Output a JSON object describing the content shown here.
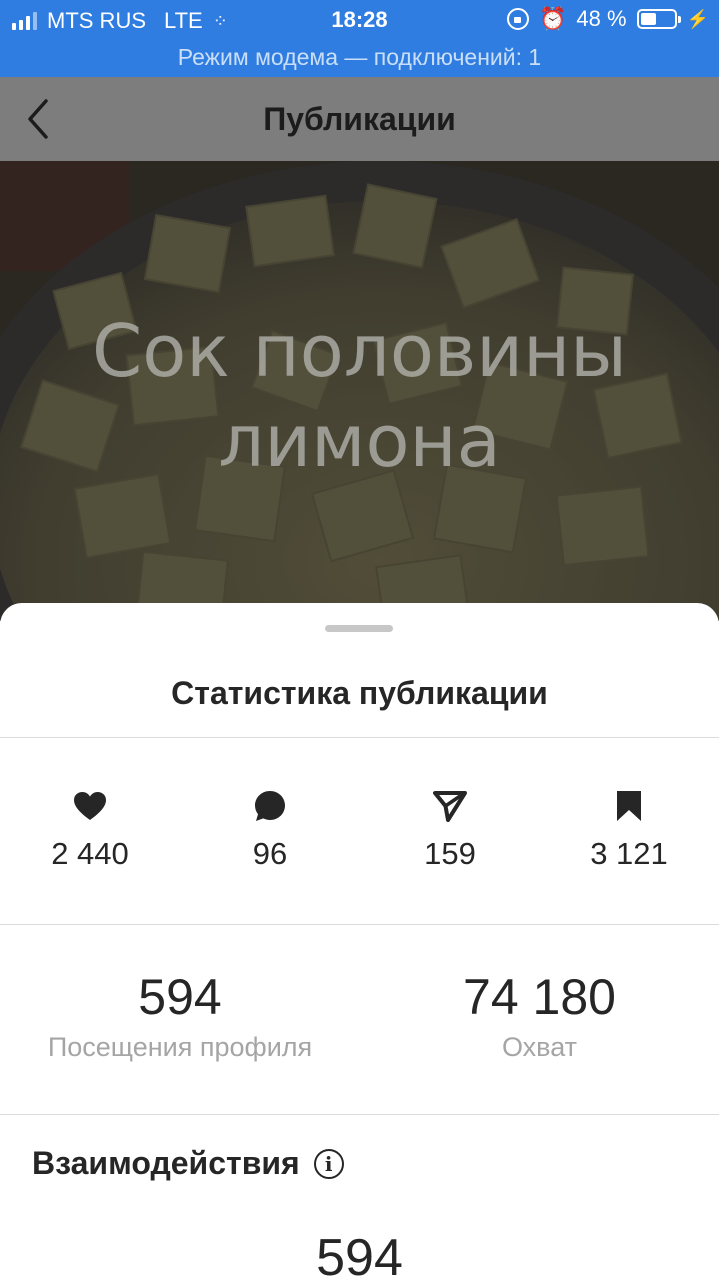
{
  "status_bar": {
    "carrier": "MTS RUS",
    "network": "LTE",
    "time": "18:28",
    "battery_text": "48 %",
    "battery_level": 0.48
  },
  "hotspot_banner": "Режим модема — подключений: 1",
  "header": {
    "title": "Публикации"
  },
  "post": {
    "overlay_text_line1": "Сок половины",
    "overlay_text_line2": "лимона"
  },
  "sheet": {
    "title": "Статистика публикации",
    "metrics": [
      {
        "icon": "heart-icon",
        "value": "2 440"
      },
      {
        "icon": "comment-icon",
        "value": "96"
      },
      {
        "icon": "share-icon",
        "value": "159"
      },
      {
        "icon": "bookmark-icon",
        "value": "3 121"
      }
    ],
    "profile_visits": {
      "value": "594",
      "label": "Посещения профиля"
    },
    "reach": {
      "value": "74 180",
      "label": "Охват"
    },
    "interactions": {
      "title": "Взаимодействия",
      "value": "594"
    }
  },
  "colors": {
    "status_bar_bg": "#2f7de1",
    "header_bg": "#7d7d7d",
    "text_primary": "#262626",
    "text_secondary": "#a5a5a5"
  }
}
